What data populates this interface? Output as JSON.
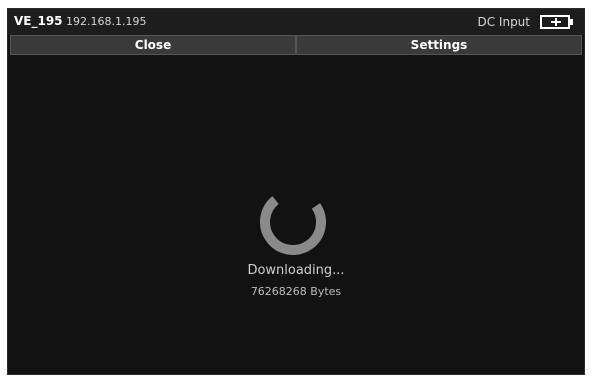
{
  "titlebar": {
    "device_name": "VE_195",
    "ip_address": "192.168.1.195",
    "power_status": "DC Input",
    "power_icon": "battery-icon"
  },
  "toolbar": {
    "close_label": "Close",
    "settings_label": "Settings"
  },
  "download": {
    "status": "Downloading...",
    "bytes": "76268268 Bytes",
    "spinner_icon": "loading-spinner-icon"
  },
  "colors": {
    "background": "#141414",
    "button": "#3a3a3a",
    "spinner": "#8a8a8a"
  }
}
